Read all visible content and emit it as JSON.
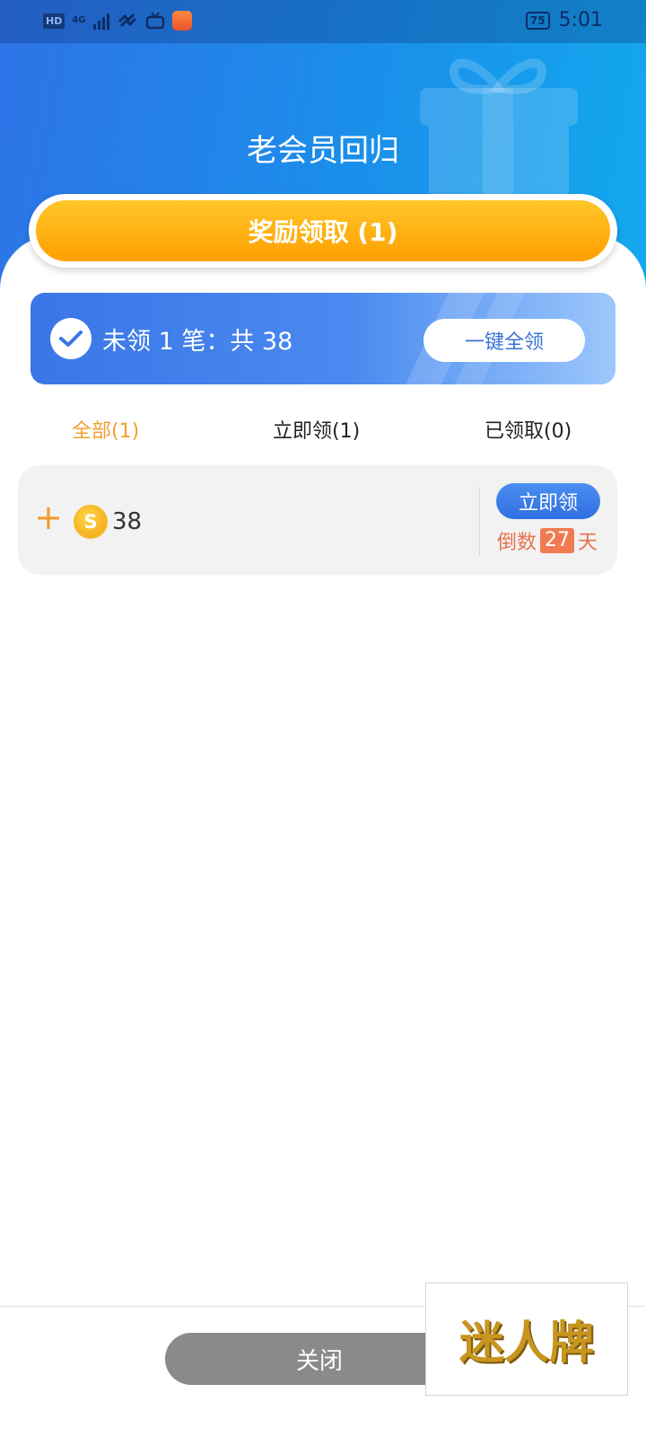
{
  "status_bar": {
    "hd": "HD",
    "network": "4G",
    "battery": "75",
    "time": "5:01"
  },
  "header": {
    "title": "老会员回归"
  },
  "claim_button": {
    "label": "奖励领取 (1)"
  },
  "summary": {
    "text": "未领 1 笔：共 38",
    "claim_all_label": "一键全领"
  },
  "tabs": [
    {
      "label": "全部(1)",
      "active": true
    },
    {
      "label": "立即领(1)",
      "active": false
    },
    {
      "label": "已领取(0)",
      "active": false
    }
  ],
  "reward_item": {
    "plus": "+",
    "coin_symbol": "S",
    "amount": "38",
    "claim_label": "立即领",
    "countdown_prefix": "倒数",
    "countdown_days": "27",
    "countdown_suffix": "天"
  },
  "footer": {
    "close_label": "关闭"
  },
  "watermark": "迷人牌",
  "colors": {
    "accent_orange": "#ff9f00",
    "primary_blue": "#2f6ee0",
    "tab_active": "#f0a030",
    "countdown": "#f07a52"
  }
}
